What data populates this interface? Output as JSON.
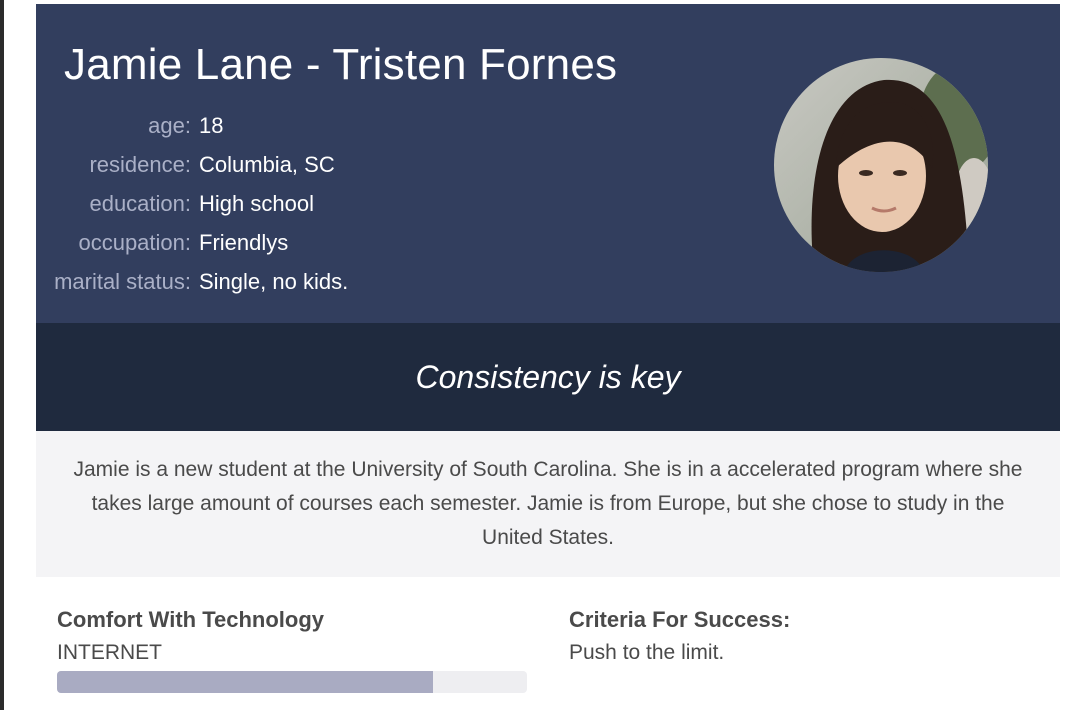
{
  "persona": {
    "name": "Jamie Lane - Tristen Fornes",
    "facts": [
      {
        "label": "age:",
        "value": "18"
      },
      {
        "label": "residence:",
        "value": "Columbia, SC"
      },
      {
        "label": "education:",
        "value": "High school"
      },
      {
        "label": "occupation:",
        "value": "Friendlys"
      },
      {
        "label": "marital status:",
        "value": "Single, no kids."
      }
    ],
    "quote": "Consistency is key",
    "bio": "Jamie is a new student at the University of South Carolina. She is in a accelerated program where she takes large amount of courses each semester. Jamie is from Europe, but she chose to study in the United States."
  },
  "technology": {
    "title": "Comfort With Technology",
    "items": [
      {
        "label": "INTERNET",
        "level": 0.8
      }
    ]
  },
  "criteria": {
    "title": "Criteria For Success:",
    "text": "Push to the limit."
  },
  "colors": {
    "header_bg": "#323e5e",
    "quote_bg": "#1f2a3e",
    "bio_bg": "#f4f4f6",
    "bar_fill": "#a9abc2",
    "bar_track": "#eeeef1"
  }
}
